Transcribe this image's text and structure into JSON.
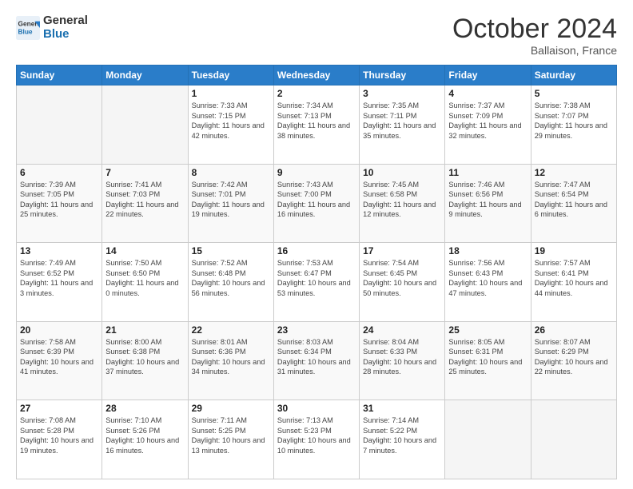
{
  "header": {
    "logo_line1": "General",
    "logo_line2": "Blue",
    "month": "October 2024",
    "location": "Ballaison, France"
  },
  "days_of_week": [
    "Sunday",
    "Monday",
    "Tuesday",
    "Wednesday",
    "Thursday",
    "Friday",
    "Saturday"
  ],
  "weeks": [
    [
      {
        "day": "",
        "sunrise": "",
        "sunset": "",
        "daylight": ""
      },
      {
        "day": "",
        "sunrise": "",
        "sunset": "",
        "daylight": ""
      },
      {
        "day": "1",
        "sunrise": "Sunrise: 7:33 AM",
        "sunset": "Sunset: 7:15 PM",
        "daylight": "Daylight: 11 hours and 42 minutes."
      },
      {
        "day": "2",
        "sunrise": "Sunrise: 7:34 AM",
        "sunset": "Sunset: 7:13 PM",
        "daylight": "Daylight: 11 hours and 38 minutes."
      },
      {
        "day": "3",
        "sunrise": "Sunrise: 7:35 AM",
        "sunset": "Sunset: 7:11 PM",
        "daylight": "Daylight: 11 hours and 35 minutes."
      },
      {
        "day": "4",
        "sunrise": "Sunrise: 7:37 AM",
        "sunset": "Sunset: 7:09 PM",
        "daylight": "Daylight: 11 hours and 32 minutes."
      },
      {
        "day": "5",
        "sunrise": "Sunrise: 7:38 AM",
        "sunset": "Sunset: 7:07 PM",
        "daylight": "Daylight: 11 hours and 29 minutes."
      }
    ],
    [
      {
        "day": "6",
        "sunrise": "Sunrise: 7:39 AM",
        "sunset": "Sunset: 7:05 PM",
        "daylight": "Daylight: 11 hours and 25 minutes."
      },
      {
        "day": "7",
        "sunrise": "Sunrise: 7:41 AM",
        "sunset": "Sunset: 7:03 PM",
        "daylight": "Daylight: 11 hours and 22 minutes."
      },
      {
        "day": "8",
        "sunrise": "Sunrise: 7:42 AM",
        "sunset": "Sunset: 7:01 PM",
        "daylight": "Daylight: 11 hours and 19 minutes."
      },
      {
        "day": "9",
        "sunrise": "Sunrise: 7:43 AM",
        "sunset": "Sunset: 7:00 PM",
        "daylight": "Daylight: 11 hours and 16 minutes."
      },
      {
        "day": "10",
        "sunrise": "Sunrise: 7:45 AM",
        "sunset": "Sunset: 6:58 PM",
        "daylight": "Daylight: 11 hours and 12 minutes."
      },
      {
        "day": "11",
        "sunrise": "Sunrise: 7:46 AM",
        "sunset": "Sunset: 6:56 PM",
        "daylight": "Daylight: 11 hours and 9 minutes."
      },
      {
        "day": "12",
        "sunrise": "Sunrise: 7:47 AM",
        "sunset": "Sunset: 6:54 PM",
        "daylight": "Daylight: 11 hours and 6 minutes."
      }
    ],
    [
      {
        "day": "13",
        "sunrise": "Sunrise: 7:49 AM",
        "sunset": "Sunset: 6:52 PM",
        "daylight": "Daylight: 11 hours and 3 minutes."
      },
      {
        "day": "14",
        "sunrise": "Sunrise: 7:50 AM",
        "sunset": "Sunset: 6:50 PM",
        "daylight": "Daylight: 11 hours and 0 minutes."
      },
      {
        "day": "15",
        "sunrise": "Sunrise: 7:52 AM",
        "sunset": "Sunset: 6:48 PM",
        "daylight": "Daylight: 10 hours and 56 minutes."
      },
      {
        "day": "16",
        "sunrise": "Sunrise: 7:53 AM",
        "sunset": "Sunset: 6:47 PM",
        "daylight": "Daylight: 10 hours and 53 minutes."
      },
      {
        "day": "17",
        "sunrise": "Sunrise: 7:54 AM",
        "sunset": "Sunset: 6:45 PM",
        "daylight": "Daylight: 10 hours and 50 minutes."
      },
      {
        "day": "18",
        "sunrise": "Sunrise: 7:56 AM",
        "sunset": "Sunset: 6:43 PM",
        "daylight": "Daylight: 10 hours and 47 minutes."
      },
      {
        "day": "19",
        "sunrise": "Sunrise: 7:57 AM",
        "sunset": "Sunset: 6:41 PM",
        "daylight": "Daylight: 10 hours and 44 minutes."
      }
    ],
    [
      {
        "day": "20",
        "sunrise": "Sunrise: 7:58 AM",
        "sunset": "Sunset: 6:39 PM",
        "daylight": "Daylight: 10 hours and 41 minutes."
      },
      {
        "day": "21",
        "sunrise": "Sunrise: 8:00 AM",
        "sunset": "Sunset: 6:38 PM",
        "daylight": "Daylight: 10 hours and 37 minutes."
      },
      {
        "day": "22",
        "sunrise": "Sunrise: 8:01 AM",
        "sunset": "Sunset: 6:36 PM",
        "daylight": "Daylight: 10 hours and 34 minutes."
      },
      {
        "day": "23",
        "sunrise": "Sunrise: 8:03 AM",
        "sunset": "Sunset: 6:34 PM",
        "daylight": "Daylight: 10 hours and 31 minutes."
      },
      {
        "day": "24",
        "sunrise": "Sunrise: 8:04 AM",
        "sunset": "Sunset: 6:33 PM",
        "daylight": "Daylight: 10 hours and 28 minutes."
      },
      {
        "day": "25",
        "sunrise": "Sunrise: 8:05 AM",
        "sunset": "Sunset: 6:31 PM",
        "daylight": "Daylight: 10 hours and 25 minutes."
      },
      {
        "day": "26",
        "sunrise": "Sunrise: 8:07 AM",
        "sunset": "Sunset: 6:29 PM",
        "daylight": "Daylight: 10 hours and 22 minutes."
      }
    ],
    [
      {
        "day": "27",
        "sunrise": "Sunrise: 7:08 AM",
        "sunset": "Sunset: 5:28 PM",
        "daylight": "Daylight: 10 hours and 19 minutes."
      },
      {
        "day": "28",
        "sunrise": "Sunrise: 7:10 AM",
        "sunset": "Sunset: 5:26 PM",
        "daylight": "Daylight: 10 hours and 16 minutes."
      },
      {
        "day": "29",
        "sunrise": "Sunrise: 7:11 AM",
        "sunset": "Sunset: 5:25 PM",
        "daylight": "Daylight: 10 hours and 13 minutes."
      },
      {
        "day": "30",
        "sunrise": "Sunrise: 7:13 AM",
        "sunset": "Sunset: 5:23 PM",
        "daylight": "Daylight: 10 hours and 10 minutes."
      },
      {
        "day": "31",
        "sunrise": "Sunrise: 7:14 AM",
        "sunset": "Sunset: 5:22 PM",
        "daylight": "Daylight: 10 hours and 7 minutes."
      },
      {
        "day": "",
        "sunrise": "",
        "sunset": "",
        "daylight": ""
      },
      {
        "day": "",
        "sunrise": "",
        "sunset": "",
        "daylight": ""
      }
    ]
  ]
}
